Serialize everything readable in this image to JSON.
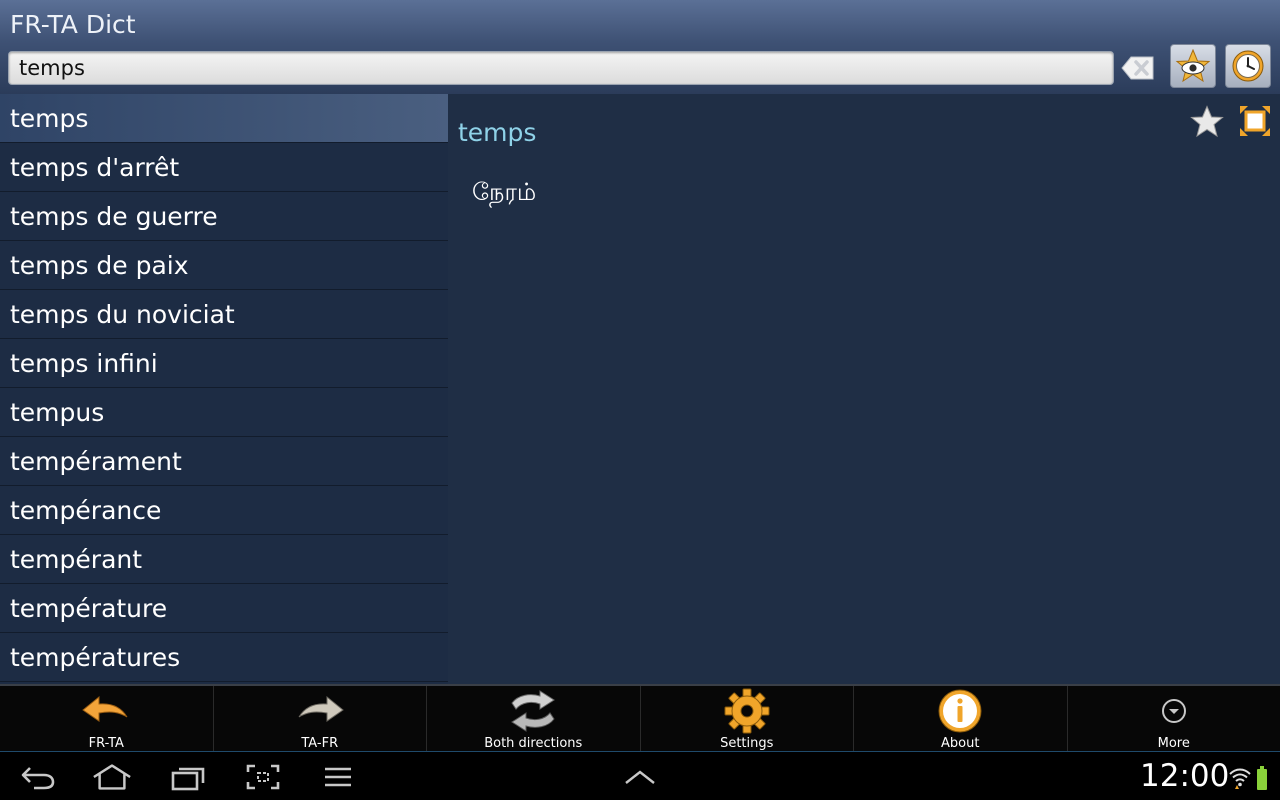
{
  "app": {
    "title": "FR-TA Dict"
  },
  "search": {
    "value": "temps"
  },
  "word_list": {
    "items": [
      {
        "label": "temps",
        "selected": true
      },
      {
        "label": "temps d'arrêt"
      },
      {
        "label": "temps de guerre"
      },
      {
        "label": "temps de paix"
      },
      {
        "label": "temps du noviciat"
      },
      {
        "label": "temps infini"
      },
      {
        "label": "tempus"
      },
      {
        "label": "tempérament"
      },
      {
        "label": "tempérance"
      },
      {
        "label": "tempérant"
      },
      {
        "label": "température"
      },
      {
        "label": "températures"
      }
    ]
  },
  "detail": {
    "word": "temps",
    "translation": "நேரம்"
  },
  "toolbar": {
    "buttons": [
      {
        "label": "FR-TA",
        "icon": "arrow-left-icon"
      },
      {
        "label": "TA-FR",
        "icon": "arrow-right-icon"
      },
      {
        "label": "Both directions",
        "icon": "swap-icon"
      },
      {
        "label": "Settings",
        "icon": "gear-icon"
      },
      {
        "label": "About",
        "icon": "info-icon"
      },
      {
        "label": "More",
        "icon": "chevron-down-icon"
      }
    ]
  },
  "system": {
    "time": "12:00"
  },
  "colors": {
    "accent": "#8fd2e8",
    "header": "#3e5174",
    "list_bg": "#1d2c44",
    "selected": "#4a5f80"
  }
}
